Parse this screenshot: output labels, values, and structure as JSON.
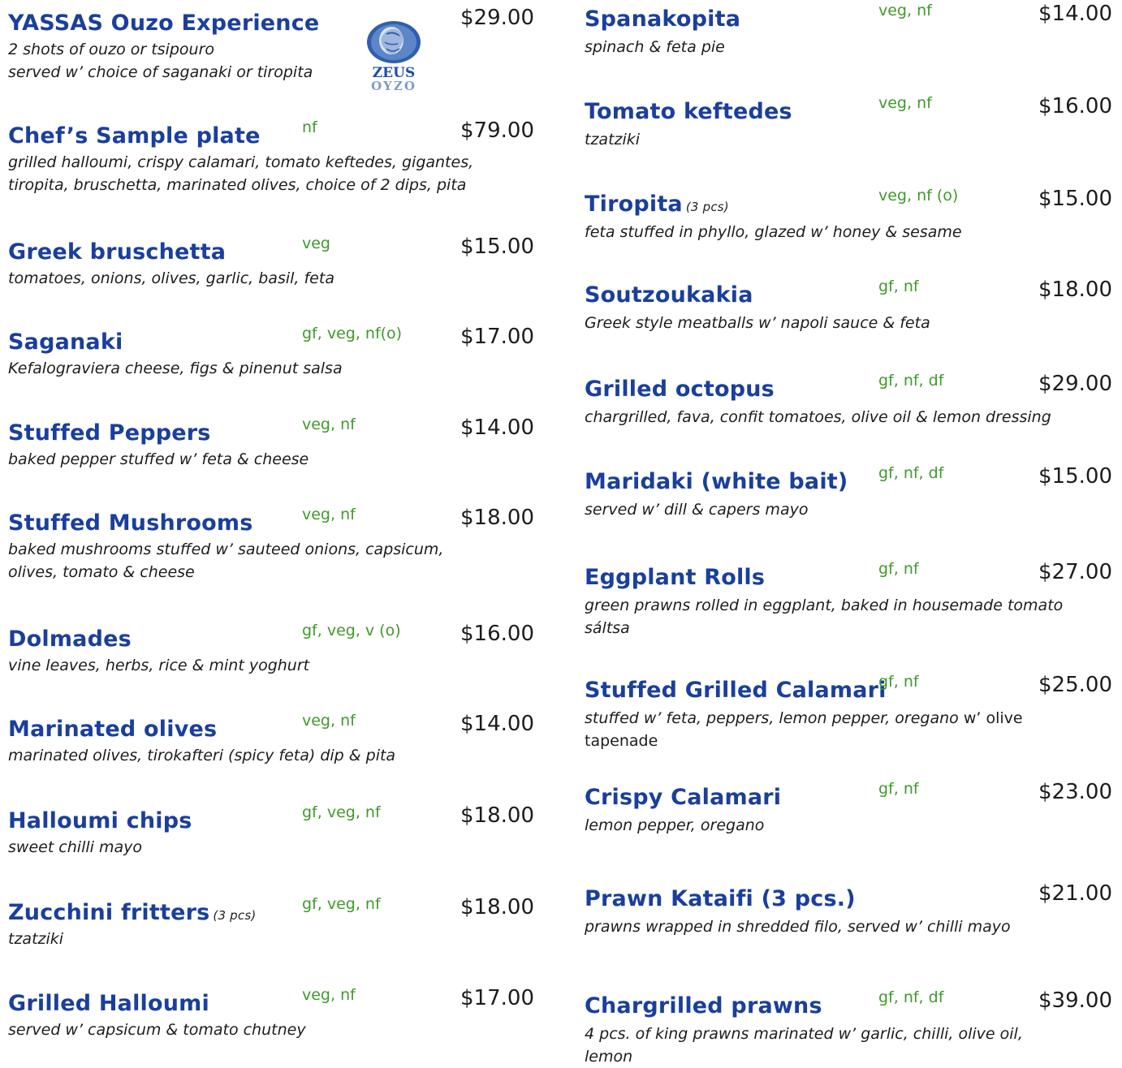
{
  "logo": {
    "line1": "ZEUS",
    "line2": "OYZO"
  },
  "left": [
    {
      "title": "YASSAS Ouzo Experience",
      "qty": "",
      "tags": "",
      "price": "$29.00",
      "desc": "2 shots of ouzo or tsipouro\nserved w’ choice of saganaki  or tiropita"
    },
    {
      "title": "Chef’s Sample plate",
      "qty": "",
      "tags": "nf",
      "price": "$79.00",
      "desc": "grilled halloumi, crispy calamari, tomato keftedes, gigantes,\ntiropita, bruschetta, marinated olives, choice of 2 dips, pita"
    },
    {
      "title": "Greek bruschetta",
      "qty": "",
      "tags": "veg",
      "price": "$15.00",
      "desc": "tomatoes, onions, olives, garlic, basil, feta"
    },
    {
      "title": "Saganaki",
      "qty": "",
      "tags": "gf, veg, nf(o)",
      "price": "$17.00",
      "desc": "Kefalograviera cheese, figs & pinenut salsa"
    },
    {
      "title": "Stuffed Peppers",
      "qty": "",
      "tags": "veg, nf",
      "price": "$14.00",
      "desc": "baked pepper stuffed w’ feta & cheese"
    },
    {
      "title": "Stuffed Mushrooms",
      "qty": "",
      "tags": "veg, nf",
      "price": "$18.00",
      "desc": "baked mushrooms stuffed w’ sauteed onions, capsicum,\nolives, tomato & cheese"
    },
    {
      "title": "Dolmades",
      "qty": "",
      "tags": "gf, veg, v (o)",
      "price": "$16.00",
      "desc": "vine leaves, herbs, rice & mint yoghurt"
    },
    {
      "title": "Marinated olives",
      "qty": "",
      "tags": "veg, nf",
      "price": "$14.00",
      "desc": "marinated olives, tirokafteri (spicy feta) dip & pita"
    },
    {
      "title": "Halloumi chips",
      "qty": "",
      "tags": "gf, veg, nf",
      "price": "$18.00",
      "desc": "sweet chilli mayo"
    },
    {
      "title": "Zucchini fritters",
      "qty": "(3 pcs)",
      "tags": "gf, veg, nf",
      "price": "$18.00",
      "desc": "tzatziki"
    },
    {
      "title": "Grilled Halloumi",
      "qty": "",
      "tags": "veg, nf",
      "price": "$17.00",
      "desc": "served w’ capsicum & tomato chutney"
    }
  ],
  "right": [
    {
      "title": "Spanakopita",
      "qty": "",
      "tags": "veg, nf",
      "price": "$14.00",
      "desc": "spinach & feta pie",
      "desc_plain": ""
    },
    {
      "title": "Tomato keftedes",
      "qty": "",
      "tags": "veg, nf",
      "price": "$16.00",
      "desc": "tzatziki",
      "desc_plain": ""
    },
    {
      "title": "Tiropita",
      "qty": "(3 pcs)",
      "tags": "veg, nf (o)",
      "price": "$15.00",
      "desc": "feta stuffed in phyllo, glazed w’ honey & sesame",
      "desc_plain": ""
    },
    {
      "title": "Soutzoukakia",
      "qty": "",
      "tags": "gf, nf",
      "price": "$18.00",
      "desc": "Greek style meatballs w’ napoli sauce & feta",
      "desc_plain": ""
    },
    {
      "title": "Grilled octopus",
      "qty": "",
      "tags": "gf, nf, df",
      "price": "$29.00",
      "desc": "chargrilled, fava, confit tomatoes, olive oil & lemon dressing",
      "desc_plain": ""
    },
    {
      "title": "Maridaki (white bait)",
      "qty": "",
      "tags": "gf, nf, df",
      "price": "$15.00",
      "desc": "served w’ dill & capers mayo",
      "desc_plain": ""
    },
    {
      "title": "Eggplant Rolls",
      "qty": "",
      "tags": "gf, nf",
      "price": "$27.00",
      "desc": "green prawns rolled in eggplant, baked in housemade tomato\nsáltsa",
      "desc_plain": ""
    },
    {
      "title": "Stuffed Grilled Calamari",
      "qty": "",
      "tags": "gf, nf",
      "price": "$25.00",
      "desc": "stuffed w’ feta, peppers, lemon pepper, oregano",
      "desc_plain": " w’ olive\ntapenade"
    },
    {
      "title": "Crispy Calamari",
      "qty": "",
      "tags": "gf, nf",
      "price": "$23.00",
      "desc": "lemon pepper, oregano",
      "desc_plain": ""
    },
    {
      "title": "Prawn Kataifi (3 pcs.)",
      "qty": "",
      "tags": "",
      "price": "$21.00",
      "desc": "prawns wrapped in shredded filo, served w’ chilli mayo",
      "desc_plain": ""
    },
    {
      "title": "Chargrilled prawns",
      "qty": "",
      "tags": "gf, nf, df",
      "price": "$39.00",
      "desc": "4 pcs. of king prawns marinated w’ garlic, chilli, olive oil,\nlemon",
      "desc_plain": ""
    }
  ]
}
